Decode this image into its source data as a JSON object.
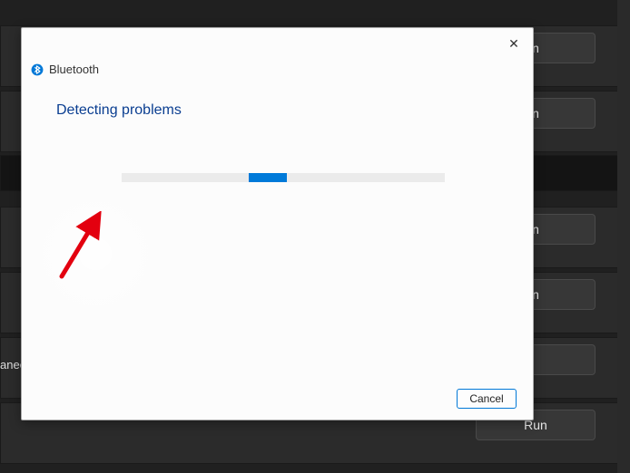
{
  "modal": {
    "title": "Bluetooth",
    "heading": "Detecting problems",
    "cancel_label": "Cancel"
  },
  "background": {
    "trunc_text_1": "n",
    "trunc_text_2": "n",
    "trunc_text_3": "n",
    "trunc_text_4": "n",
    "trunc_text_5": "anec",
    "run_label": "Run"
  },
  "icons": {
    "close": "✕",
    "bluetooth": "bluetooth-icon"
  }
}
